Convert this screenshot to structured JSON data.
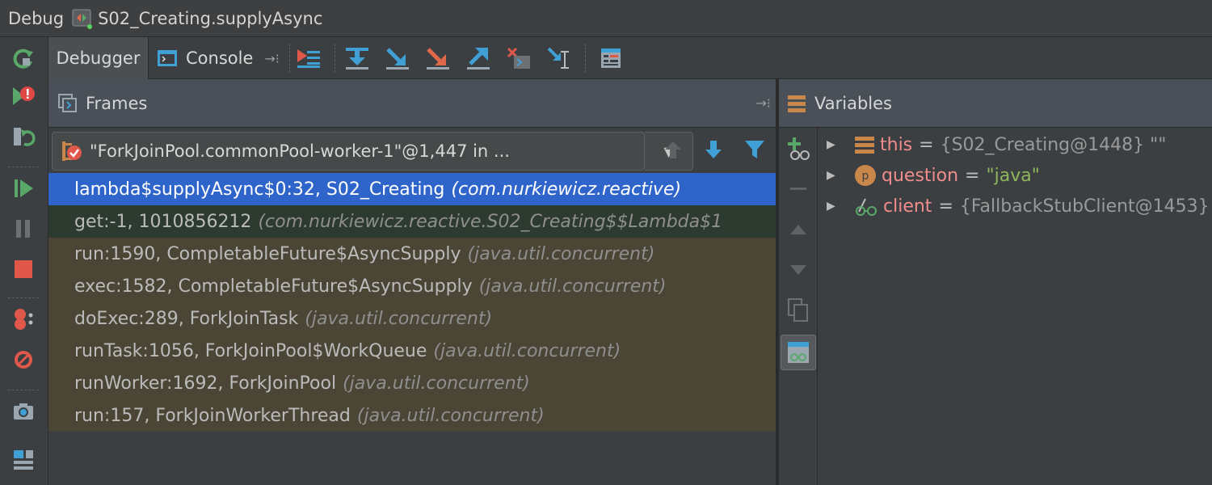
{
  "window": {
    "title_prefix": "Debug",
    "config_name": "S02_Creating.supplyAsync"
  },
  "toolbar": {
    "tabs": [
      {
        "label": "Debugger",
        "active": true
      },
      {
        "label": "Console",
        "active": false
      }
    ],
    "icons": [
      "show-execution-point-icon",
      "step-over-icon",
      "step-into-icon",
      "force-step-into-icon",
      "step-out-icon",
      "drop-frame-icon",
      "run-to-cursor-icon",
      "evaluate-expression-icon"
    ]
  },
  "sidebar": {
    "icons": [
      "rerun-icon",
      "breakpoint-exception-icon",
      "restore-layout-icon",
      "resume-icon",
      "pause-icon",
      "stop-icon",
      "view-breakpoints-icon",
      "mute-breakpoints-icon",
      "snapshot-icon",
      "layout-settings-icon"
    ]
  },
  "frames": {
    "title": "Frames",
    "thread": "\"ForkJoinPool.commonPool-worker-1\"@1,447 in ...",
    "items": [
      {
        "location": "lambda$supplyAsync$0:32, S02_Creating",
        "package": "(com.nurkiewicz.reactive)",
        "state": "selected"
      },
      {
        "location": "get:-1, 1010856212",
        "package": "(com.nurkiewicz.reactive.S02_Creating$$Lambda$1",
        "state": "lambda"
      },
      {
        "location": "run:1590, CompletableFuture$AsyncSupply",
        "package": "(java.util.concurrent)",
        "state": "lib"
      },
      {
        "location": "exec:1582, CompletableFuture$AsyncSupply",
        "package": "(java.util.concurrent)",
        "state": "lib"
      },
      {
        "location": "doExec:289, ForkJoinTask",
        "package": "(java.util.concurrent)",
        "state": "lib"
      },
      {
        "location": "runTask:1056, ForkJoinPool$WorkQueue",
        "package": "(java.util.concurrent)",
        "state": "lib"
      },
      {
        "location": "runWorker:1692, ForkJoinPool",
        "package": "(java.util.concurrent)",
        "state": "lib"
      },
      {
        "location": "run:157, ForkJoinWorkerThread",
        "package": "(java.util.concurrent)",
        "state": "lib"
      }
    ]
  },
  "variables": {
    "title": "Variables",
    "items": [
      {
        "name": "this",
        "eq": "=",
        "value": "{S02_Creating@1448} \"\"",
        "kind": "object"
      },
      {
        "name": "question",
        "eq": "=",
        "value": "\"java\"",
        "kind": "param"
      },
      {
        "name": "client",
        "eq": "=",
        "value": "{FallbackStubClient@1453}",
        "kind": "watch"
      }
    ]
  },
  "colors": {
    "selected_frame": "#2f65ca",
    "library_frame": "#4b4536",
    "lambda_frame": "#2d3a2f",
    "variable_name": "#f08c8c",
    "string_value": "#8fb65b"
  }
}
